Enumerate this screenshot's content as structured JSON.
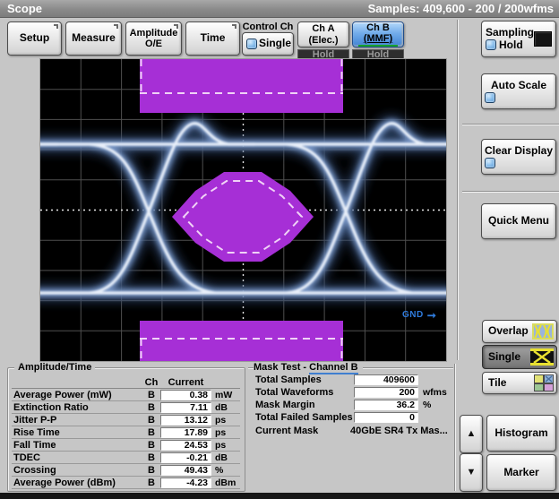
{
  "title_bar": {
    "app_name": "Scope",
    "samples_info": "Samples: 409,600 - 200 / 200wfms"
  },
  "toolbar": {
    "setup": "Setup",
    "measure": "Measure",
    "amplitude_oe": "Amplitude O/E",
    "time": "Time",
    "control_ch_label": "Control Ch",
    "single_label": "Single",
    "ch_a": {
      "line1": "Ch A",
      "line2": "(Elec.)",
      "hold": "Hold"
    },
    "ch_b": {
      "line1": "Ch B",
      "line2": "(MMF)",
      "hold": "Hold"
    }
  },
  "right_panel": {
    "sampling_line1": "Sampling",
    "sampling_line2": "Hold",
    "auto_scale": "Auto Scale",
    "clear_display": "Clear Display",
    "quick_menu": "Quick Menu",
    "overlap": "Overlap",
    "single": "Single",
    "tile": "Tile",
    "histogram": "Histogram",
    "marker": "Marker"
  },
  "icons": {
    "up_arrow": "▲",
    "down_arrow": "▼",
    "gnd_arrow": "➞"
  },
  "display": {
    "gnd_label": "GND",
    "mask_color": "#a62fd6",
    "trace_color": "#e8eff9",
    "grid_color": "#4f4f4f"
  },
  "amplitude_time": {
    "title": "Amplitude/Time",
    "col_ch": "Ch",
    "col_current": "Current",
    "rows": [
      {
        "name": "Average Power (mW)",
        "ch": "B",
        "value": "0.38",
        "unit": "mW"
      },
      {
        "name": "Extinction Ratio",
        "ch": "B",
        "value": "7.11",
        "unit": "dB"
      },
      {
        "name": "Jitter P-P",
        "ch": "B",
        "value": "13.12",
        "unit": "ps"
      },
      {
        "name": "Rise Time",
        "ch": "B",
        "value": "17.89",
        "unit": "ps"
      },
      {
        "name": "Fall Time",
        "ch": "B",
        "value": "24.53",
        "unit": "ps"
      },
      {
        "name": "TDEC",
        "ch": "B",
        "value": "-0.21",
        "unit": "dB"
      },
      {
        "name": "Crossing",
        "ch": "B",
        "value": "49.43",
        "unit": "%"
      },
      {
        "name": "Average Power (dBm)",
        "ch": "B",
        "value": "-4.23",
        "unit": "dBm"
      }
    ]
  },
  "mask_test": {
    "title_prefix": "Mask Test - ",
    "channel": "Channel B",
    "rows": [
      {
        "label": "Total Samples",
        "value": "409600",
        "unit": ""
      },
      {
        "label": "Total Waveforms",
        "value": "200",
        "unit": "wfms"
      },
      {
        "label": "Mask Margin",
        "value": "36.2",
        "unit": "%"
      },
      {
        "label": "Total Failed Samples",
        "value": "0",
        "unit": ""
      }
    ],
    "current_mask_label": "Current Mask",
    "current_mask_value": "40GbE SR4 Tx Mas..."
  }
}
